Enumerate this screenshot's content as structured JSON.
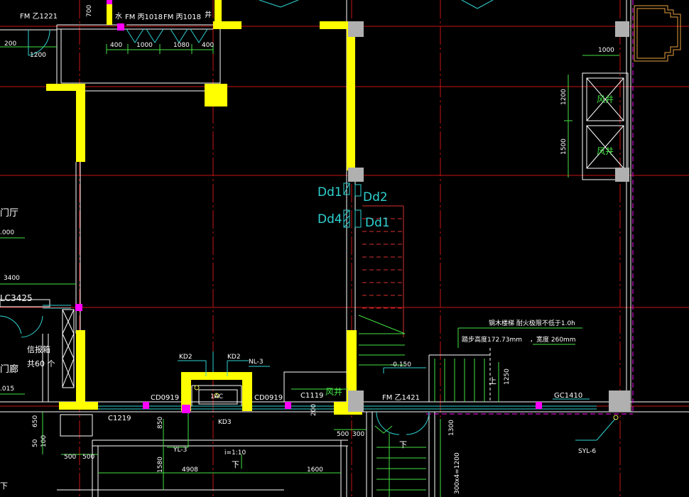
{
  "colors": {
    "background": "#000000",
    "wall": "#ffff00",
    "column": "#b0b0b0",
    "axis": "#c81414",
    "line": "#ffffff",
    "cyan": "#2fd2d2",
    "green": "#43e243",
    "magenta": "#ff00ff"
  },
  "labels": {
    "fm_zj221": "FM 乙1221",
    "fm_bing1018_a": "FM 丙1018",
    "fm_bing1018_b": "FM 丙1018",
    "fm_zj1421": "FM 乙1421",
    "shui": "水",
    "jing": "井",
    "dd1_a": "Dd1",
    "dd2": "Dd2",
    "dd4": "Dd4",
    "dd1_b": "Dd1",
    "fengjing_1": "风井",
    "fengjing_2": "风井",
    "fengjing_3": "风井",
    "menting": "门厅",
    "menting_elev": ".000",
    "menlang": "门廊",
    "menlang_elev": ".015",
    "lc3425": "LC3425",
    "xinbaoxiang": "信报箱",
    "gong60": "共60 个",
    "kd2_a": "KD2",
    "kd2_b": "KD2",
    "nl3": "NL-3",
    "ac": "1AC",
    "kd3": "KD3",
    "cd0919_a": "CD0919",
    "cd0919_b": "CD0919",
    "c1119": "C1119",
    "c1219": "C1219",
    "gc1410": "GC1410",
    "yl3": "YL-3",
    "syl6": "SYL-6",
    "slope": "i=1:10",
    "xia_1": "下",
    "xia_2": "下",
    "xia_3": "下",
    "shang": "上",
    "elev_0150": "-0.150",
    "stair_note_1": "钢木楼梯 耐火极限不低于1.0h",
    "stair_note_2": "踏步高度172.73mm",
    "stair_note_3": "，宽度 260mm"
  },
  "dimensions": {
    "d700": "700",
    "d200": "200",
    "d1200": "1200",
    "d400_a": "400",
    "d1000": "1000",
    "d1080": "1080",
    "d400_b": "400",
    "d1000_r": "1000",
    "d1200_v": "1200",
    "d1500_v": "1500",
    "d3400": "3400",
    "d1250": "1250",
    "d650": "650",
    "d50": "50",
    "d100": "100",
    "d500_a": "500",
    "d500_b": "500",
    "d850": "850",
    "d1580": "1580",
    "d4908": "4908",
    "d1600": "1600",
    "d500_c": "500",
    "d300": "300",
    "d1300": "1300",
    "d300x4": "300x4=1200",
    "d200_s": "200"
  }
}
